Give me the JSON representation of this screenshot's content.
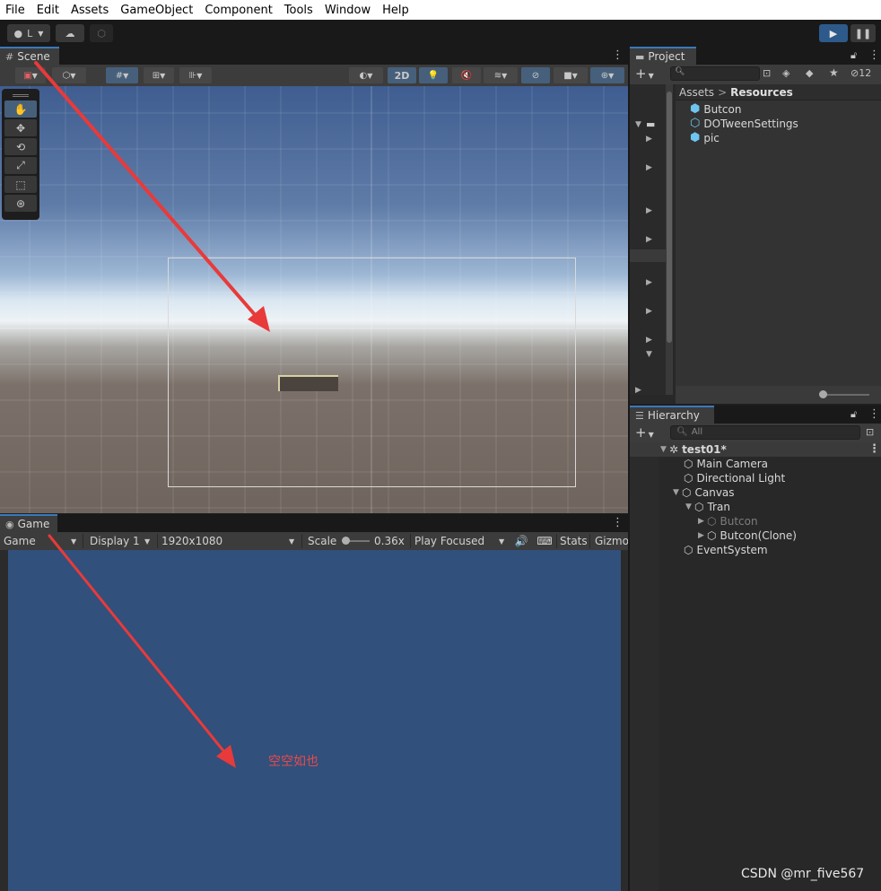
{
  "menu": [
    "File",
    "Edit",
    "Assets",
    "GameObject",
    "Component",
    "Tools",
    "Window",
    "Help"
  ],
  "main_toolbar": {
    "account_label": "L",
    "cloud_icon": "cloud-icon",
    "play_icon": "play-icon",
    "pause_icon": "pause-icon"
  },
  "scene": {
    "tab_label": "Scene",
    "toggle_2d_label": "2D"
  },
  "game": {
    "tab_label": "Game",
    "view_mode": "Game",
    "display": "Display 1",
    "resolution": "1920x1080",
    "scale_label": "Scale",
    "scale_value": "0.36x",
    "play_mode": "Play Focused",
    "stats_label": "Stats",
    "gizmos_label": "Gizmo",
    "empty_note": "空空如也"
  },
  "project": {
    "tab_label": "Project",
    "hidden_count": "12",
    "breadcrumb_root": "Assets",
    "breadcrumb_separator": ">",
    "breadcrumb_current": "Resources",
    "assets": [
      "Butcon",
      "DOTweenSettings",
      "pic"
    ]
  },
  "hierarchy": {
    "tab_label": "Hierarchy",
    "search_placeholder": "All",
    "scene_name": "test01*",
    "items": {
      "main_camera": "Main Camera",
      "directional_light": "Directional Light",
      "canvas": "Canvas",
      "tran": "Tran",
      "butcon": "Butcon",
      "butcon_clone": "Butcon(Clone)",
      "event_system": "EventSystem"
    }
  },
  "watermark": "CSDN @mr_five567",
  "colors": {
    "accent_blue": "#3a79bb",
    "game_background": "#31507c",
    "annotation_red": "#e83a3a",
    "asset_cube": "#6ec6f0"
  }
}
